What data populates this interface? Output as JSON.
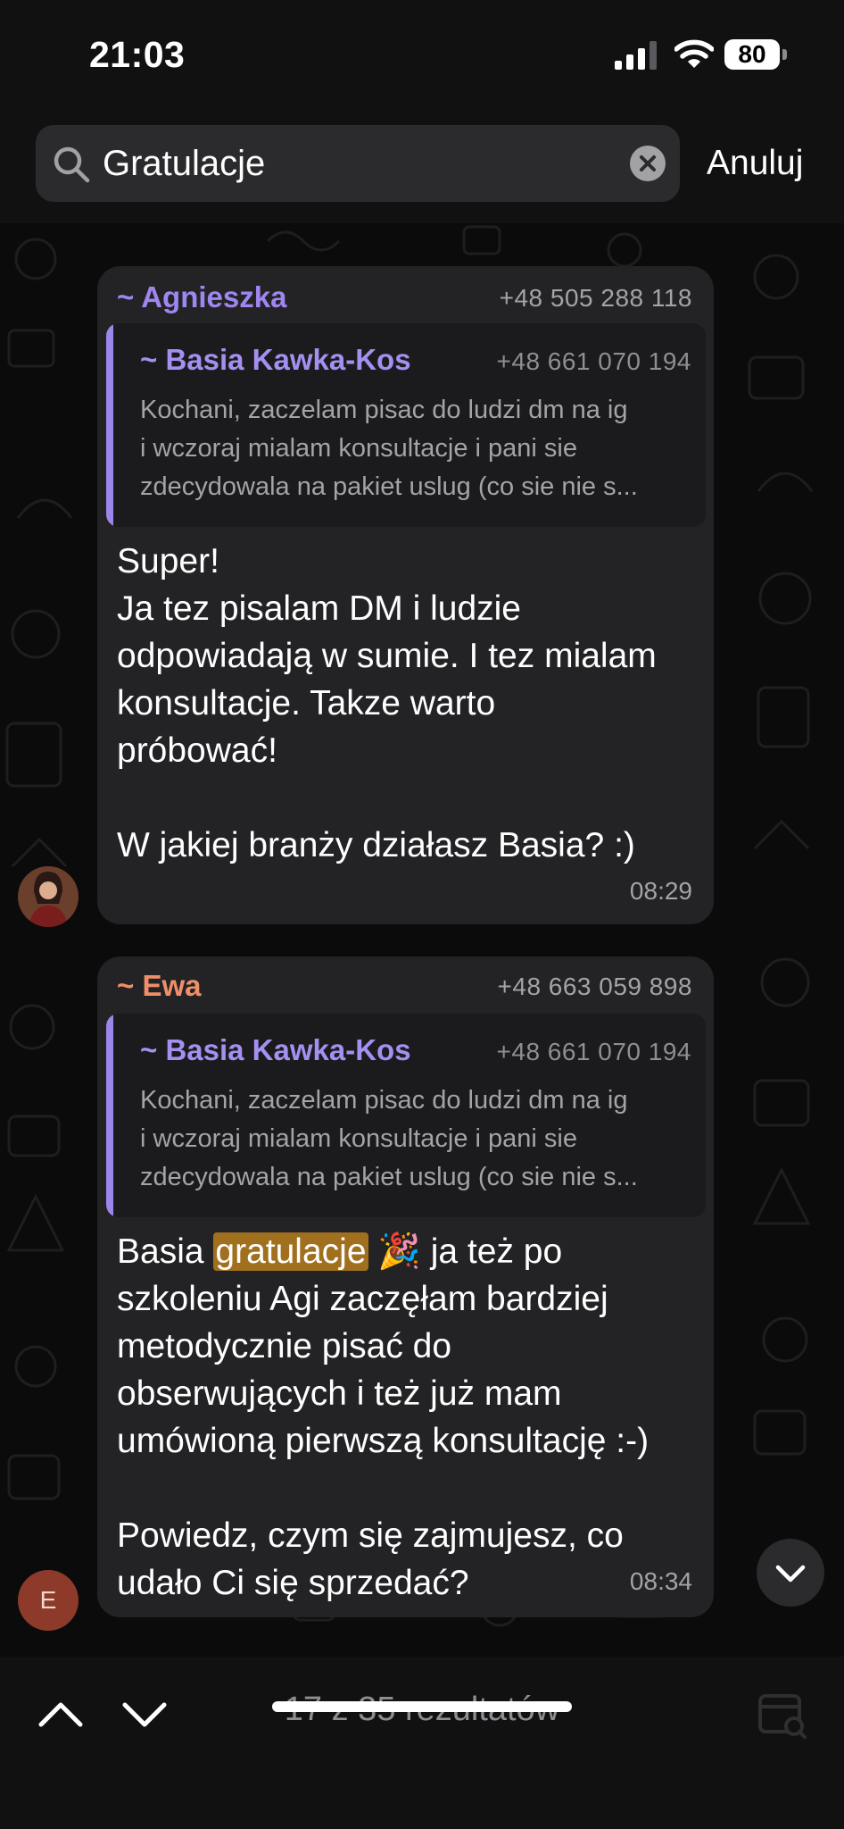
{
  "status": {
    "time": "21:03",
    "battery": "80"
  },
  "search": {
    "query": "Gratulacje",
    "cancel_label": "Anuluj"
  },
  "messages": [
    {
      "sender": "~ Agnieszka",
      "sender_color": "#9f86f0",
      "phone": "+48 505 288 118",
      "quote": {
        "sender": "~ Basia Kawka-Kos",
        "phone": "+48 661 070 194",
        "lines": [
          "Kochani, zaczelam pisac do ludzi dm na ig",
          "i wczoraj mialam konsultacje i pani sie",
          "zdecydowala na pakiet uslug (co sie nie s..."
        ]
      },
      "text_lines": [
        "Super!",
        "Ja tez pisalam DM i ludzie",
        "odpowiadają w sumie. I tez mialam",
        "konsultacje. Takze warto",
        "próbować!",
        "",
        "W jakiej branży działasz Basia? :)"
      ],
      "time": "08:29"
    },
    {
      "sender": "~ Ewa",
      "sender_color": "#ef8f6a",
      "phone": "+48 663 059 898",
      "quote": {
        "sender": "~ Basia Kawka-Kos",
        "phone": "+48 661 070 194",
        "lines": [
          "Kochani, zaczelam pisac do ludzi dm na ig",
          "i wczoraj mialam konsultacje i pani sie",
          "zdecydowala na pakiet uslug (co sie nie s..."
        ]
      },
      "first_line": {
        "before": "Basia ",
        "highlight": "gratulacje",
        "after": " 🎉 ja też po"
      },
      "text_lines": [
        "szkoleniu Agi zaczęłam bardziej",
        "metodycznie pisać do",
        "obserwujących i też już mam",
        "umówioną pierwszą konsultację :-)",
        "",
        "Powiedz, czym się zajmujesz, co",
        "udało Ci się sprzedać?"
      ],
      "time": "08:34",
      "avatar_initial": "E"
    }
  ],
  "results": {
    "label": "17 z 35 rezultatów"
  },
  "colors": {
    "highlight": "#a1701f",
    "quote_accent": "#9d86ea",
    "bubble": "#232325"
  }
}
